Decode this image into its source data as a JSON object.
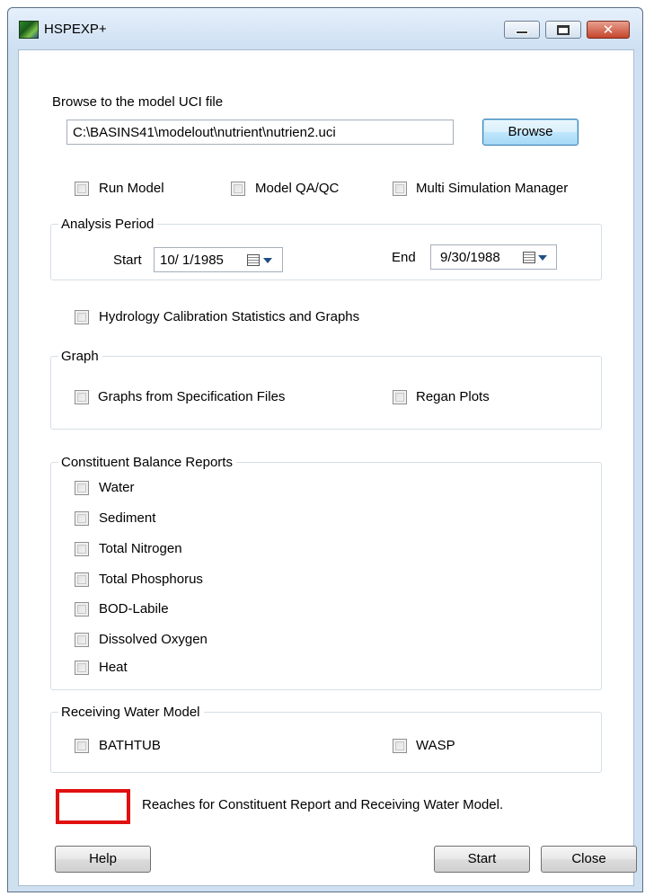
{
  "window": {
    "title": "HSPEXP+"
  },
  "uci": {
    "label": "Browse to the model UCI file",
    "path": "C:\\BASINS41\\modelout\\nutrient\\nutrien2.uci",
    "browse_label": "Browse"
  },
  "options": {
    "run_model": "Run Model",
    "model_qaqc": "Model QA/QC",
    "multi_sim": "Multi Simulation Manager"
  },
  "analysis_period": {
    "title": "Analysis Period",
    "start_label": "Start",
    "start_value": "10/ 1/1985",
    "end_label": "End",
    "end_value": "9/30/1988"
  },
  "hydrology": {
    "label": "Hydrology Calibration Statistics and Graphs"
  },
  "graph": {
    "title": "Graph",
    "spec_files": "Graphs from Specification Files",
    "regan": "Regan Plots"
  },
  "constituents": {
    "title": "Constituent Balance Reports",
    "items": [
      {
        "label": "Water"
      },
      {
        "label": "Sediment"
      },
      {
        "label": "Total Nitrogen"
      },
      {
        "label": "Total Phosphorus"
      },
      {
        "label": "BOD-Labile"
      },
      {
        "label": "Dissolved Oxygen"
      },
      {
        "label": "Heat"
      }
    ]
  },
  "receiving": {
    "title": "Receiving Water Model",
    "bathtub": "BATHTUB",
    "wasp": "WASP"
  },
  "reaches": {
    "value": "",
    "label": "Reaches for Constituent Report and Receiving Water Model."
  },
  "footer": {
    "help": "Help",
    "start": "Start",
    "close": "Close"
  },
  "colors": {
    "highlight_border": "#e01010",
    "window_frame": "#cfe0f1"
  }
}
